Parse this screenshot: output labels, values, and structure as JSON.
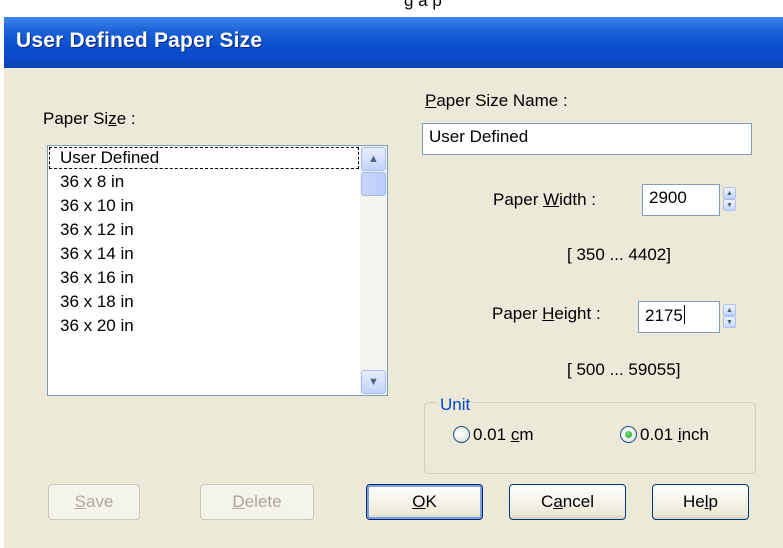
{
  "top_strip_text": "g         a     p",
  "title": "User Defined Paper Size",
  "paper_size": {
    "label_pre": "Paper Si",
    "label_mn": "z",
    "label_post": "e :",
    "items": [
      "User Defined",
      "36 x 8 in",
      "36 x 10 in",
      "36 x 12 in",
      "36 x 14 in",
      "36 x 16 in",
      "36 x 18 in",
      "36 x 20 in"
    ]
  },
  "paper_size_name": {
    "label_mn": "P",
    "label_post": "aper Size Name :",
    "value": "User Defined"
  },
  "paper_width": {
    "label_pre": "Paper ",
    "label_mn": "W",
    "label_post": "idth  :",
    "value": "2900",
    "range": "[  350 ...  4402]"
  },
  "paper_height": {
    "label_pre": "Paper ",
    "label_mn": "H",
    "label_post": "eight :",
    "value": "2175",
    "range": "[  500 ...  59055]"
  },
  "unit": {
    "legend": "Unit",
    "cm_pre": "0.01 ",
    "cm_mn": "c",
    "cm_post": "m",
    "inch_pre": "0.01 ",
    "inch_mn": "i",
    "inch_post": "nch",
    "selected": "inch"
  },
  "buttons": {
    "save_mn": "S",
    "save_post": "ave",
    "delete_mn": "D",
    "delete_post": "elete",
    "ok_mn": "O",
    "ok_post": "K",
    "cancel_pre": "C",
    "cancel_mn": "a",
    "cancel_post": "ncel",
    "help_pre": "He",
    "help_mn": "l",
    "help_post": "p"
  },
  "colors": {
    "titlebar": "#0a4fd0",
    "dialog_bg": "#ece9d8",
    "group_legend": "#0046d5",
    "radio_checked": "#21a121"
  },
  "icons": {
    "scroll_up": "▲",
    "scroll_down": "▼",
    "spin_up": "▲",
    "spin_down": "▼"
  }
}
